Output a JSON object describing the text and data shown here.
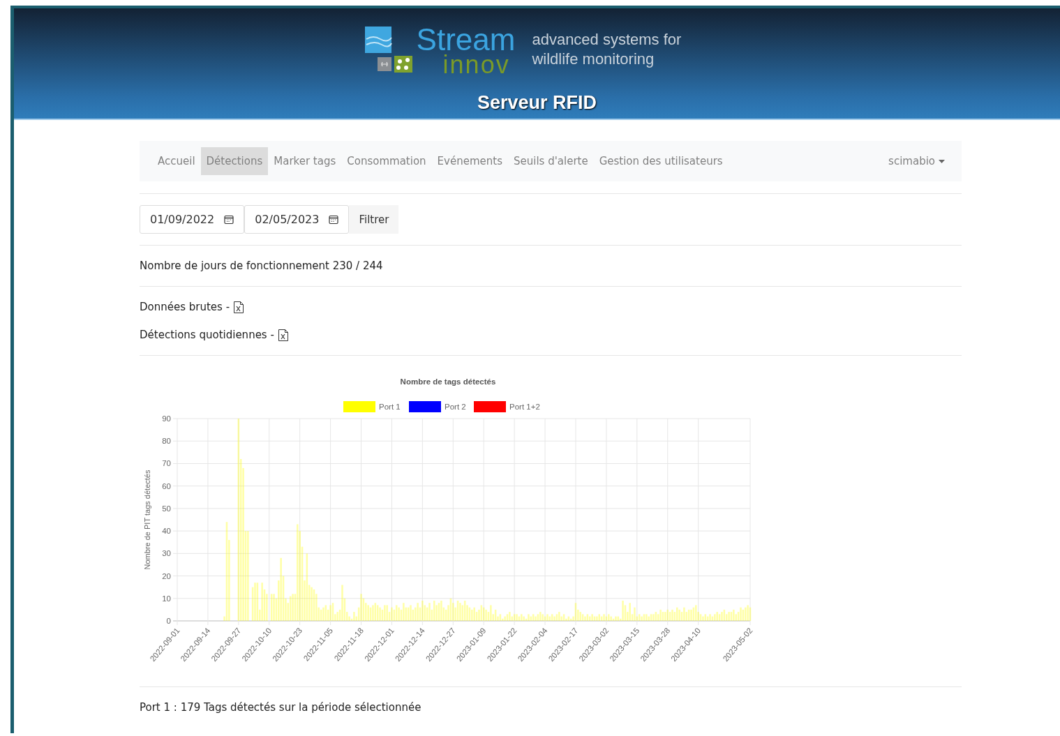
{
  "header": {
    "logo_top": "Stream",
    "logo_bottom": "innov",
    "tagline": [
      "advanced systems for",
      "wildlife monitoring"
    ],
    "title": "Serveur RFID"
  },
  "nav": {
    "items": [
      {
        "label": "Accueil",
        "selected": false
      },
      {
        "label": "Détections",
        "selected": true
      },
      {
        "label": "Marker tags",
        "selected": false
      },
      {
        "label": "Consommation",
        "selected": false
      },
      {
        "label": "Evénements",
        "selected": false
      },
      {
        "label": "Seuils d'alerte",
        "selected": false
      },
      {
        "label": "Gestion des utilisateurs",
        "selected": false
      }
    ],
    "user": "scimabio"
  },
  "filter": {
    "start_date": "01/09/2022",
    "end_date": "02/05/2023",
    "button": "Filtrer"
  },
  "operating_days": "Nombre de jours de fonctionnement 230 / 244",
  "downloads": [
    {
      "label": "Données brutes -"
    },
    {
      "label": "Détections quotidiennes -"
    }
  ],
  "chart": {
    "legend": [
      {
        "label": "Port 2",
        "color": "#0000ff"
      },
      {
        "label": "Port 1+2",
        "color": "#ff0000"
      }
    ],
    "chart_data": {
      "type": "bar",
      "title": "Nombre de tags détectés",
      "ylabel": "Nombre de PIT tags détectés",
      "ylim": [
        0,
        90
      ],
      "yticks": [
        0,
        10,
        20,
        30,
        40,
        50,
        60,
        70,
        80,
        90
      ],
      "grid": true,
      "categories": [
        "2022-09-01",
        null,
        null,
        null,
        null,
        null,
        null,
        null,
        null,
        null,
        null,
        null,
        null,
        "2022-09-14",
        null,
        null,
        null,
        null,
        null,
        null,
        null,
        null,
        null,
        null,
        null,
        null,
        "2022-09-27",
        null,
        null,
        null,
        null,
        null,
        null,
        null,
        null,
        null,
        null,
        null,
        null,
        "2022-10-10",
        null,
        null,
        null,
        null,
        null,
        null,
        null,
        null,
        null,
        null,
        null,
        null,
        "2022-10-23",
        null,
        null,
        null,
        null,
        null,
        null,
        null,
        null,
        null,
        null,
        null,
        null,
        "2022-11-05",
        null,
        null,
        null,
        null,
        null,
        null,
        null,
        null,
        null,
        null,
        null,
        null,
        "2022-11-18",
        null,
        null,
        null,
        null,
        null,
        null,
        null,
        null,
        null,
        null,
        null,
        null,
        "2022-12-01",
        null,
        null,
        null,
        null,
        null,
        null,
        null,
        null,
        null,
        null,
        null,
        null,
        "2022-12-14",
        null,
        null,
        null,
        null,
        null,
        null,
        null,
        null,
        null,
        null,
        null,
        null,
        "2022-12-27",
        null,
        null,
        null,
        null,
        null,
        null,
        null,
        null,
        null,
        null,
        null,
        null,
        "2023-01-09",
        null,
        null,
        null,
        null,
        null,
        null,
        null,
        null,
        null,
        null,
        null,
        null,
        "2023-01-22",
        null,
        null,
        null,
        null,
        null,
        null,
        null,
        null,
        null,
        null,
        null,
        null,
        "2023-02-04",
        null,
        null,
        null,
        null,
        null,
        null,
        null,
        null,
        null,
        null,
        null,
        null,
        "2023-02-17",
        null,
        null,
        null,
        null,
        null,
        null,
        null,
        null,
        null,
        null,
        null,
        null,
        "2023-03-02",
        null,
        null,
        null,
        null,
        null,
        null,
        null,
        null,
        null,
        null,
        null,
        null,
        "2023-03-15",
        null,
        null,
        null,
        null,
        null,
        null,
        null,
        null,
        null,
        null,
        null,
        null,
        "2023-03-28",
        null,
        null,
        null,
        null,
        null,
        null,
        null,
        null,
        null,
        null,
        null,
        null,
        "2023-04-10",
        null,
        null,
        null,
        null,
        null,
        null,
        null,
        null,
        null,
        null,
        null,
        null,
        null,
        null,
        null,
        null,
        null,
        null,
        null,
        null,
        null,
        "2023-05-02"
      ],
      "series": [
        {
          "name": "Port 1",
          "color": "#ffff00",
          "values": [
            0,
            0,
            0,
            0,
            0,
            0,
            0,
            0,
            0,
            0,
            0,
            0,
            0,
            0,
            0,
            0,
            0,
            0,
            0,
            0,
            2,
            44,
            36,
            0,
            0,
            0,
            90,
            72,
            68,
            40,
            40,
            0,
            15,
            17,
            17,
            5,
            17,
            14,
            12,
            0,
            12,
            12,
            10,
            18,
            28,
            20,
            10,
            8,
            11,
            12,
            12,
            43,
            40,
            33,
            18,
            30,
            16,
            15,
            14,
            12,
            6,
            5,
            6,
            7,
            5,
            7,
            8,
            3,
            4,
            5,
            16,
            10,
            4,
            2,
            1,
            4,
            2,
            6,
            12,
            10,
            8,
            7,
            6,
            7,
            8,
            7,
            6,
            5,
            7,
            7,
            4,
            6,
            5,
            7,
            6,
            5,
            8,
            6,
            6,
            7,
            5,
            6,
            8,
            6,
            9,
            7,
            6,
            8,
            5,
            9,
            7,
            8,
            9,
            6,
            5,
            7,
            10,
            8,
            6,
            9,
            8,
            7,
            9,
            7,
            6,
            5,
            6,
            4,
            5,
            7,
            6,
            5,
            4,
            7,
            3,
            5,
            2,
            3,
            1,
            2,
            3,
            4,
            2,
            3,
            3,
            2,
            3,
            2,
            1,
            3,
            2,
            3,
            2,
            3,
            4,
            3,
            2,
            3,
            2,
            3,
            2,
            3,
            4,
            2,
            3,
            1,
            2,
            1,
            2,
            8,
            5,
            4,
            3,
            2,
            3,
            2,
            3,
            2,
            2,
            3,
            2,
            3,
            2,
            3,
            2,
            1,
            2,
            2,
            1,
            9,
            7,
            4,
            8,
            3,
            6,
            2,
            3,
            2,
            3,
            3,
            2,
            3,
            3,
            4,
            3,
            5,
            4,
            4,
            5,
            4,
            5,
            4,
            6,
            5,
            4,
            6,
            4,
            5,
            5,
            6,
            7,
            4,
            3,
            2,
            3,
            2,
            3,
            2,
            3,
            4,
            3,
            4,
            5,
            3,
            4,
            4,
            5,
            3,
            4,
            6,
            5,
            6,
            7,
            6
          ]
        }
      ]
    }
  },
  "summary": "Port 1 : 179 Tags détectés sur la période sélectionnée"
}
